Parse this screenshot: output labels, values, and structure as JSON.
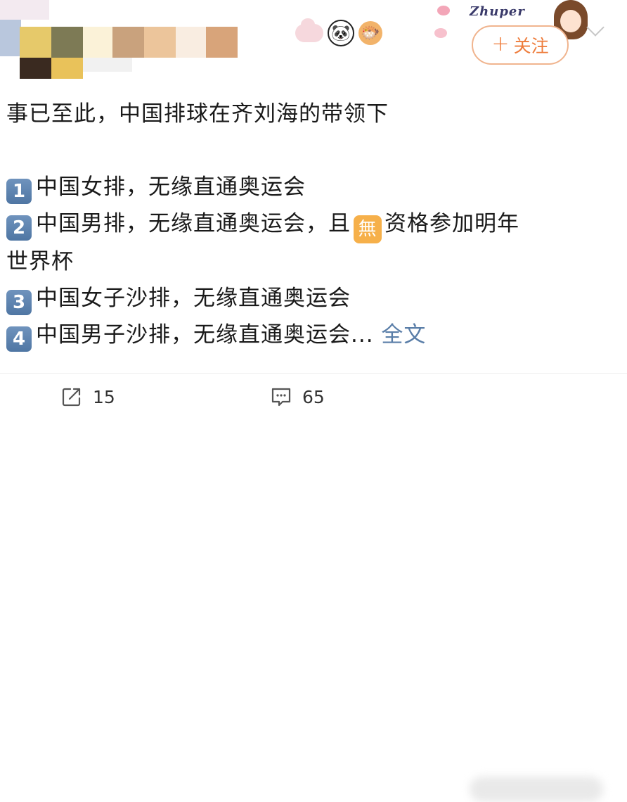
{
  "header": {
    "frame_text": "Zhuper",
    "follow_label": "关注",
    "follow_plus": "+"
  },
  "post": {
    "line_intro": "事已至此，中国排球在齐刘海的带领下",
    "items": [
      {
        "num": "1",
        "text": "中国女排，无缘直通奥运会"
      },
      {
        "num": "2",
        "text_a": "中国男排，无缘直通奥运会，且",
        "badge": "無",
        "text_b": "资格参加明年",
        "text_c": "世界杯"
      },
      {
        "num": "3",
        "text": "中国女子沙排，无缘直通奥运会"
      },
      {
        "num": "4",
        "text": "中国男子沙排，无缘直通奥运会...",
        "more": " 全文"
      }
    ]
  },
  "actions": {
    "share_count": "15",
    "comment_count": "65"
  },
  "icons": {
    "share": "share-icon",
    "comment": "comment-icon",
    "chevron": "chevron-down-icon",
    "panda": "panda-emoji-icon",
    "fish": "pufferfish-emoji-icon"
  },
  "colors": {
    "follow": "#ee7c3b",
    "link": "#5a7ea8",
    "keycap": "#5a80ad",
    "badge": "#f6b04a"
  }
}
